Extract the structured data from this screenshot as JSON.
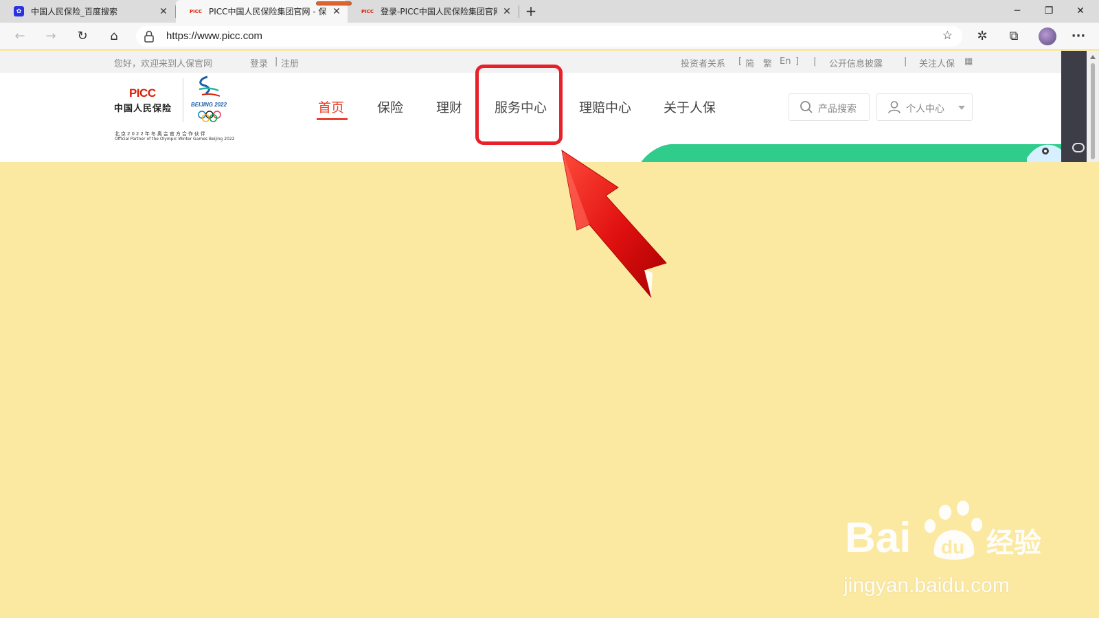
{
  "browser": {
    "tabs": [
      {
        "favicon": "baidu-paw",
        "title": "中国人民保险_百度搜索"
      },
      {
        "favicon": "PICC",
        "title": "PICC中国人民保险集团官网 - 保"
      },
      {
        "favicon": "PICC",
        "title": "登录-PICC中国人民保险集团官网"
      }
    ],
    "new_tab": "+",
    "url": "https://www.picc.com",
    "window_controls": {
      "minimize": "─",
      "restore": "❐",
      "close": "✕"
    },
    "icons": {
      "back": "←",
      "forward": "→",
      "refresh": "↻",
      "home": "⌂",
      "favorite": "☆",
      "favorites": "✲",
      "collections": "⧉",
      "menu": "···"
    }
  },
  "site": {
    "topbar": {
      "greeting": "您好，欢迎来到人保官网",
      "login": "登录",
      "sep": "|",
      "register": "注册",
      "investor": "投资者关系",
      "lang_open": "[",
      "lang_simplified": "简",
      "lang_traditional": "繁",
      "lang_english": "En",
      "lang_close": "]",
      "disclosure": "公开信息披露",
      "follow": "关注人保",
      "follow_icon": "qr-icon"
    },
    "logo": {
      "brand": "PICC",
      "name_cn": "中国人民保险",
      "olympic": "BEIJING 2022",
      "partner_cn": "北京2022年冬奥会官方合作伙伴",
      "partner_en": "Official Partner of the Olympic Winter Games Beijing 2022"
    },
    "nav": [
      {
        "label": "首页",
        "active": true
      },
      {
        "label": "保险",
        "active": false
      },
      {
        "label": "理财",
        "active": false
      },
      {
        "label": "服务中心",
        "active": false
      },
      {
        "label": "理赔中心",
        "active": false
      },
      {
        "label": "关于人保",
        "active": false
      }
    ],
    "search_label": "产品搜索",
    "user_label": "个人中心"
  },
  "watermark": {
    "brand": "Bai du 经验",
    "url": "jingyan.baidu.com"
  },
  "colors": {
    "accent": "#e8402a",
    "highlight": "#e8202a",
    "background": "#fbe9a2",
    "banner": "#2fcc8c",
    "brand": "#d81e06"
  }
}
